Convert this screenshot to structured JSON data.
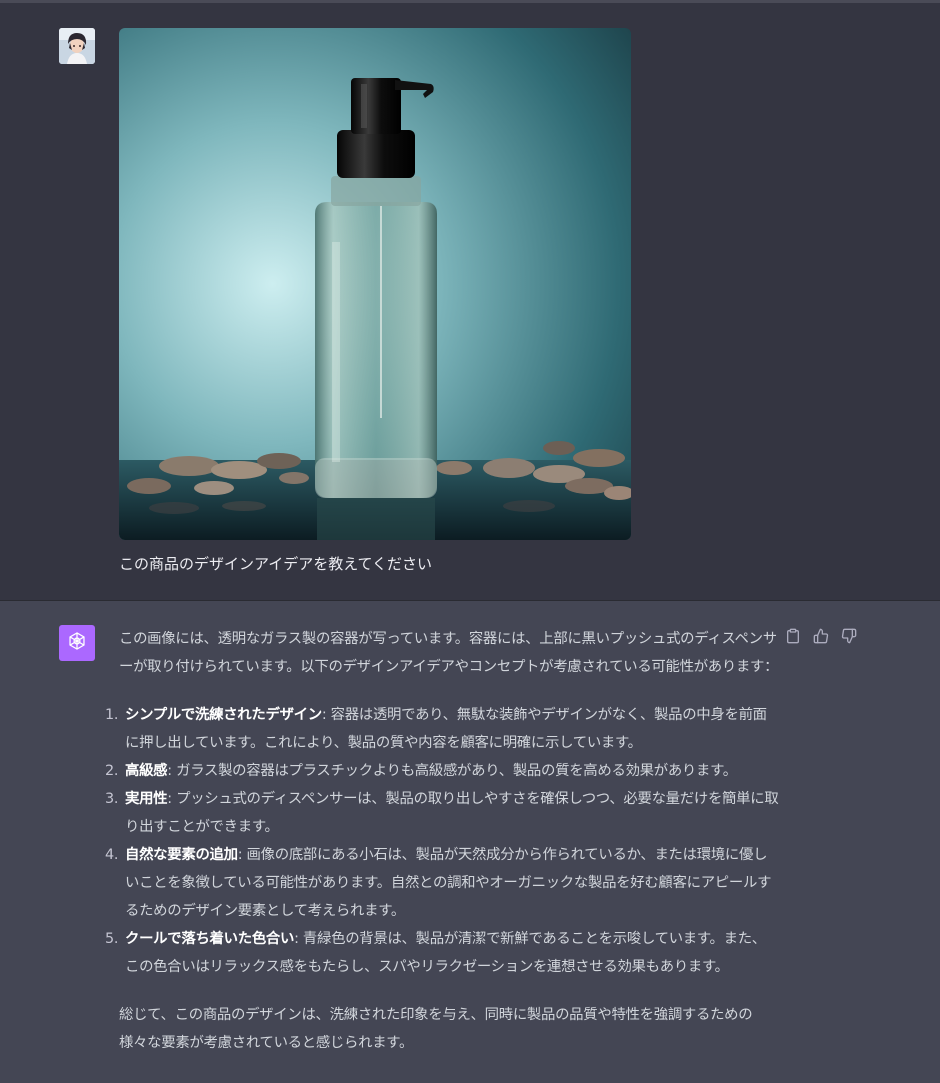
{
  "user": {
    "message": "この商品のデザインアイデアを教えてください"
  },
  "assistant": {
    "intro": "この画像には、透明なガラス製の容器が写っています。容器には、上部に黒いプッシュ式のディスペンサーが取り付けられています。以下のデザインアイデアやコンセプトが考慮されている可能性があります：",
    "items": [
      {
        "num": "1.",
        "title": "シンプルで洗練されたデザイン",
        "text": ": 容器は透明であり、無駄な装飾やデザインがなく、製品の中身を前面に押し出しています。これにより、製品の質や内容を顧客に明確に示しています。"
      },
      {
        "num": "2.",
        "title": "高級感",
        "text": ": ガラス製の容器はプラスチックよりも高級感があり、製品の質を高める効果があります。"
      },
      {
        "num": "3.",
        "title": "実用性",
        "text": ": プッシュ式のディスペンサーは、製品の取り出しやすさを確保しつつ、必要な量だけを簡単に取り出すことができます。"
      },
      {
        "num": "4.",
        "title": "自然な要素の追加",
        "text": ": 画像の底部にある小石は、製品が天然成分から作られているか、または環境に優しいことを象徴している可能性があります。自然との調和やオーガニックな製品を好む顧客にアピールするためのデザイン要素として考えられます。"
      },
      {
        "num": "5.",
        "title": "クールで落ち着いた色合い",
        "text": ": 青緑色の背景は、製品が清潔で新鮮であることを示唆しています。また、この色合いはリラックス感をもたらし、スパやリラクゼーションを連想させる効果もあります。"
      }
    ],
    "summary": "総じて、この商品のデザインは、洗練された印象を与え、同時に製品の品質や特性を強調するための様々な要素が考慮されていると感じられます。"
  },
  "icons": {
    "copy": "clipboard-icon",
    "like": "thumbs-up-icon",
    "dislike": "thumbs-down-icon",
    "bot": "openai-logo-icon"
  },
  "colors": {
    "background": "#343541",
    "assistant_background": "#444654",
    "bot_avatar": "#ab68ff"
  }
}
